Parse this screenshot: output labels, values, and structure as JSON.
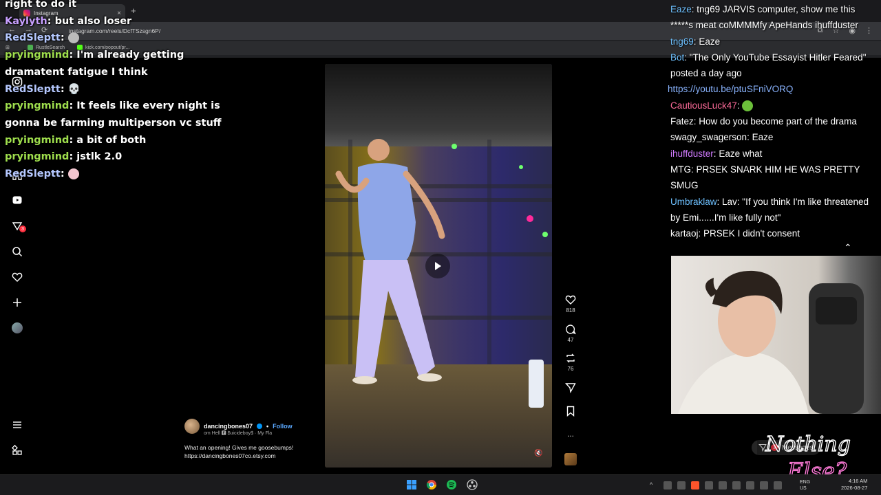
{
  "browser": {
    "tab_title": "Instagram",
    "tab_close": "×",
    "new_tab": "+",
    "url": "instagram.com/reels/DcfTSzsgn6P/",
    "bookmarks": [
      {
        "label": "RustleSearch"
      },
      {
        "label": "kick.com/popout/pr..."
      }
    ],
    "nav": {
      "back": "←",
      "forward": "→",
      "reload": "⟳"
    }
  },
  "instagram": {
    "caption": {
      "username": "dancingbones07",
      "separator": "•",
      "follow_label": "Follow",
      "audio": "om Hell 🅴 $uicideboy$ · My Fla",
      "text": "What an opening! Gives me goosebumps!",
      "link": "https://dancingbones07co.etsy.com"
    },
    "actions": {
      "likes": "818",
      "comments": "47",
      "reposts": "76"
    },
    "notifications_badge": "3",
    "messages": {
      "label": "Messages",
      "badge": "3"
    },
    "more": "..."
  },
  "chat_left": [
    {
      "user": "",
      "text": "right to do it"
    },
    {
      "user": "Kaylyth",
      "text": "but also loser"
    },
    {
      "user": "RedSleptt",
      "text": ""
    },
    {
      "user": "pryingmind",
      "text": "I'm already getting dramatent fatigue I think"
    },
    {
      "user": "RedSleptt",
      "text": "💀"
    },
    {
      "user": "pryingmind",
      "text": "It feels like every night is gonna be farming multiperson vc stuff"
    },
    {
      "user": "pryingmind",
      "text": "a bit of both"
    },
    {
      "user": "pryingmind",
      "text": "jstlk 2.0"
    },
    {
      "user": "RedSleptt",
      "text": ""
    }
  ],
  "chat_right": [
    {
      "user": "Eaze",
      "text": "tng69 JARVIS computer, show me this *****s meat coMMMMfy ApeHands ihuffduster",
      "color": "#6ec1ff"
    },
    {
      "user": "tng69",
      "text": "Eaze",
      "color": "#6ec1ff"
    },
    {
      "user": "Bot",
      "text": "\"The Only YouTube Essayist Hitler Feared\" posted a day ago",
      "color": "#6ec1ff"
    },
    {
      "user": "",
      "text": "https://youtu.be/ptuSFniVORQ",
      "color": "#8ab4ff"
    },
    {
      "user": "CautiousLuck47",
      "text": "",
      "color": "#ff6b9a"
    },
    {
      "user": "Fatez",
      "text": "How do you become part of the drama",
      "color": "#ffffff"
    },
    {
      "user": "swagy_swagerson",
      "text": "Eaze",
      "color": "#ffffff"
    },
    {
      "user": "ihuffduster",
      "text": "Eaze  what",
      "color": "#d17bff"
    },
    {
      "user": "MTG",
      "text": "PRSEK SNARK HIM  HE WAS PRETTY SMUG",
      "color": "#ffffff"
    },
    {
      "user": "Umbraklaw",
      "text": "Lav: \"If you think I'm like threatened by Emi......I'm like fully not\"",
      "color": "#6ec1ff"
    },
    {
      "user": "kartaoj",
      "text": "PRSEK I didn't consent",
      "color": "#ffffff"
    }
  ],
  "logo_text": [
    "Nothing",
    "Else?"
  ],
  "tray": {
    "lang_top": "ENG",
    "lang_bottom": "US",
    "time": "4:16 AM",
    "date": "2026-08-27"
  }
}
